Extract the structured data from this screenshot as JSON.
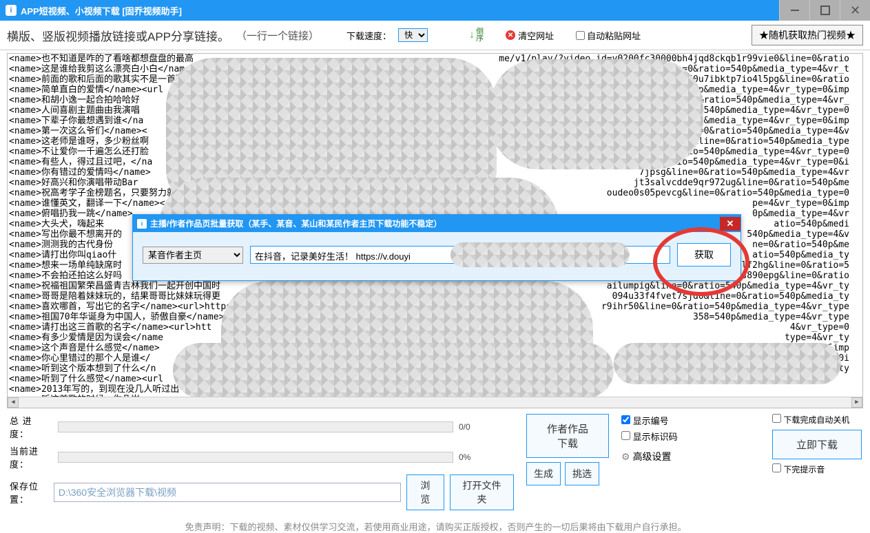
{
  "window": {
    "title": "APP短视频、小视频下载 [固乔视频助手]"
  },
  "toolbar": {
    "hint": "横版、竖版视频播放链接或APP分享链接。",
    "hint_sub": "（一行一个链接）",
    "speed_label": "下载速度：",
    "speed_value": "快",
    "sort_label": "倒序",
    "clear_label": "清空网址",
    "autopaste_label": "自动粘贴网址",
    "random_label": "★随机获取热门视频★"
  },
  "url_lines_left": [
    "<name>也不知道是咋的了看啥都想盘盘的最高",
    "<name>这是谁给我剪这么漂亮白小白</name>",
    "<name>前面的歌和后面的歌其实不是一首歌",
    "<name>简单直白的爱情</name><url",
    "<name>和胡小逸一起合拍哈哈好",
    "<name>人间喜剧主题曲由我演唱",
    "<name>下辈子你最想遇到谁</na",
    "<name>第一次这么爷们</name><",
    "<name>这老师是谁呀，多少粉丝啊",
    "<name>不让爱你一千遍怎么还打脸",
    "<name>有些人，得过且过吧，</na",
    "<name>你有错过的爱情吗</name>",
    "<name>好高兴和你演唱带动Bar",
    "<name>祝高考学子金榜题名，只要努力就",
    "<name>谁懂英文，翻译一下</name><url>https://aweme",
    "<name>俯唱扔我一跳</name>",
    "<name>大头犬，嗨起来",
    "<name>写出你最不想离开的",
    "<name>测测我的古代身份",
    "<name>请打出你叫qiao什",
    "<name>想来一场单纯缺席时",
    "<name>不会拍还拍这么好吗",
    "<name>祝福祖国繁荣昌盛青吉林我们一起开创中国时",
    "<name>哥哥是陪着妹妹玩的，结果哥哥比妹妹玩得更",
    "<name>喜欢哪首，写出它的名字</name><url>https:",
    "<name>祖国70年华诞身为中国人，骄傲自豪</name>",
    "<name>请打出这三首歌的名字</name><url>htt",
    "<name>有多少爱情是因为误会</name",
    "<name>这个声音是什么感觉</name>",
    "<name>你心里错过的那个人是谁</",
    "<name>听到这个版本想到了什么</n",
    "<name>听到了什么感觉</name><url",
    "<name>2013年写的，到现在没几人听过出",
    "<name>听这首歌的时候，你几岁"
  ],
  "url_lines_right": [
    "me/v1/play/?video_id=v0200fc30000bh4jqd8ckqb1r99vie0&line=0&ratio",
    "200f0d0000bh5b2ln2q7hvng&line=0&ratio=540p&media_type=4&vr_t",
    "1/play/?video_id=v0200f600000bht60u7ibktp7io4l5pg&line=0&ratio",
    "47ovo91hievd6t10&line=0&ratio=540p&media_type=4&vr_type=0&imp",
    "                     line=0&ratio=540p&media_type=4&vr_",
    "                  io=540p&media_type=4&vr_type=0",
    "                  =540p&media_type=4&vr_type=0&imp",
    "                  ine=0&ratio=540p&media_type=4&v",
    "                  dr0&line=0&ratio=540p&media_type",
    "                  ine=0&ratio=540p&media_type=4&vr_type=0",
    "                  e=0&ratio=540p&media_type=4&vr_type=0&i",
    "                  7jpsg&line=0&ratio=540p&media_type=4&vr",
    "                  jt3salvcdde9qr972ug&line=0&ratio=540p&me",
    "                  oudeo0s05pevcg&line=0&ratio=540p&media_type=0",
    "                  pe=4&vr_type=0&imp",
    "                  0p&media_type=4&vr",
    "                  atio=540p&medi",
    "                  540p&media_type=4&v",
    "                  ne=0&ratio=540p&me",
    "                  atio=540p&media_ty",
    "         v0200fc90000bm4uqmamac2jfjdlf2hg&line=0&ratio=5",
    "          o_id=v0200f90000bs08167pq3n8s890epg&line=0&ratio",
    "          ailumpig&line=0&ratio=540p&media_type=4&vr_ty",
    "          094u33f4fvet7sjd0&line=0&ratio=540p&media_ty",
    "          r9ihr50&line=0&ratio=540p&media_type=4&vr_type",
    "          358=540p&media_type=4&vr_type",
    "                 4&vr_type=0",
    "               type=4&vr_ty",
    "               e=4&vr_type=0&imp",
    "               30000bmul5ti0i",
    "         atio=540p&media_type=4&vr_ty"
  ],
  "modal": {
    "title": "主播/作者作品页批量获取（某手、某音、某山和某民作者主页下载功能不稳定）",
    "select_value": "某音作者主页",
    "input_value": "在抖音，记录美好生活！ https://v.douyi",
    "fetch_label": "获取"
  },
  "bottom": {
    "total_label": "总 进 度：",
    "total_value": "0/0",
    "current_label": "当前进度：",
    "current_value": "0%",
    "save_label": "保存位置：",
    "save_path": "D:\\360安全浏览器下载\\视频",
    "browse": "浏览",
    "open_folder": "打开文件夹",
    "generate": "生成",
    "pick": "挑选",
    "advanced": "高级设置",
    "author_dl": "作者作品下载",
    "download_now": "立即下载",
    "show_number": "显示编号",
    "show_code": "显示标识码",
    "auto_shutdown": "下载完成自动关机",
    "finish_sound": "下完提示音"
  },
  "disclaimer": "免责声明：下载的视频、素材仅供学习交流，若使用商业用途，请购买正版授权，否则产生的一切后果将由下载用户自行承担。"
}
